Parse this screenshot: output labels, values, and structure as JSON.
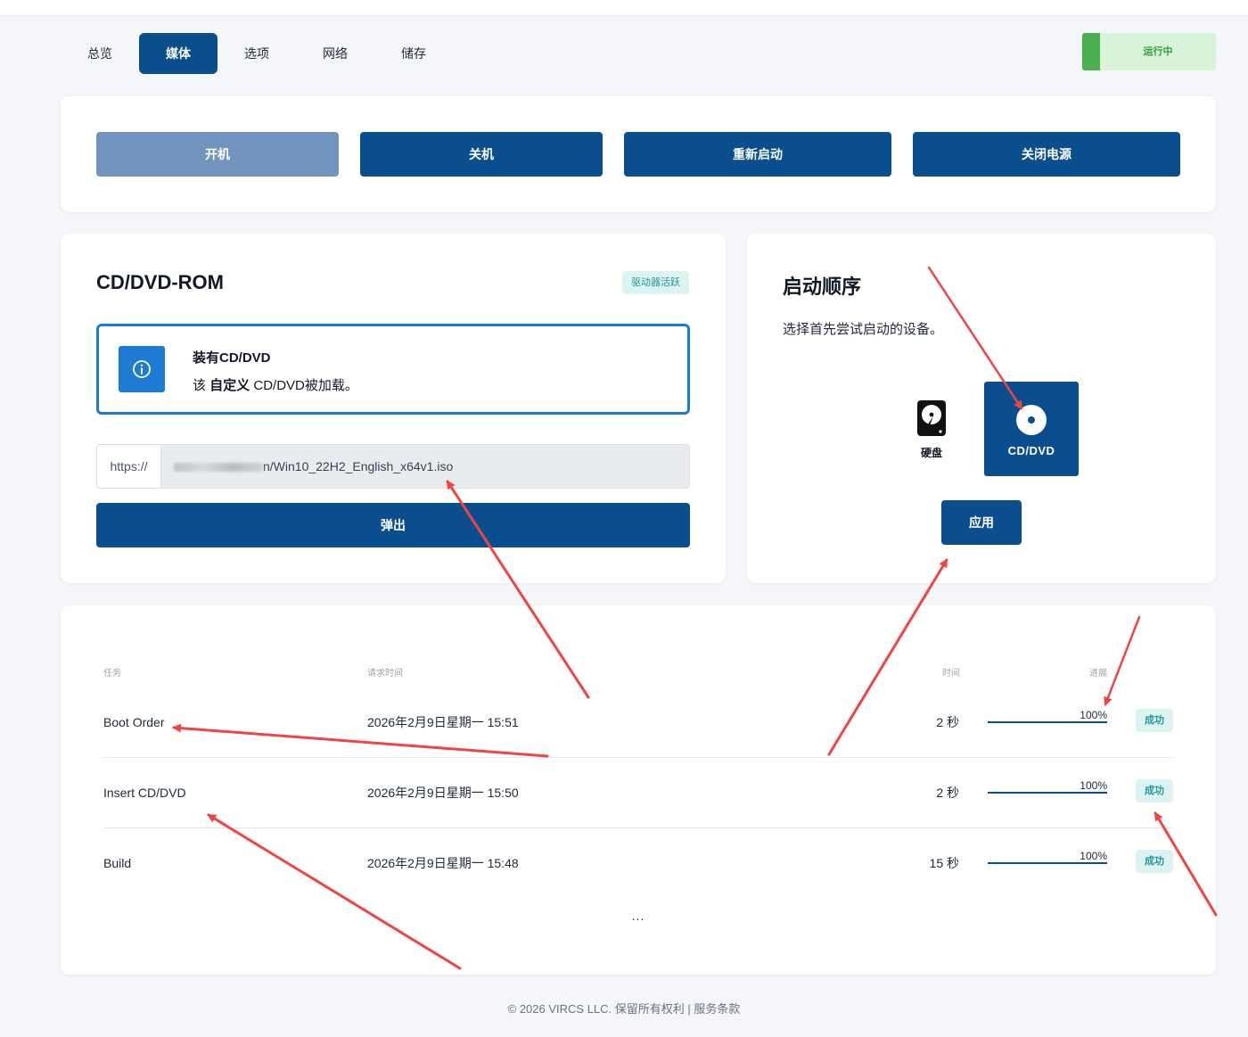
{
  "tabs": [
    {
      "label": "总览"
    },
    {
      "label": "媒体",
      "active": true
    },
    {
      "label": "选项"
    },
    {
      "label": "网络"
    },
    {
      "label": "储存"
    }
  ],
  "status": {
    "label": "运行中",
    "color": "#4caf50"
  },
  "power": {
    "power_on": "开机",
    "shutdown": "关机",
    "restart": "重新启动",
    "power_off": "关闭电源"
  },
  "cdrom": {
    "title": "CD/DVD-ROM",
    "badge": "驱动器活跃",
    "info_title": "装有CD/DVD",
    "info_prefix": "该",
    "info_strong": "自定义",
    "info_suffix": "CD/DVD被加载。",
    "url_prefix": "https://",
    "url_value": "n/Win10_22H2_English_x64v1.iso",
    "eject": "弹出"
  },
  "boot": {
    "title": "启动顺序",
    "description": "选择首先尝试启动的设备。",
    "hdd_label": "硬盘",
    "cd_label": "CD/DVD",
    "selected": "CD/DVD",
    "apply": "应用"
  },
  "tasks": {
    "headers": {
      "task": "任务",
      "requested": "请求时间",
      "duration": "时间",
      "progress": "进展"
    },
    "rows": [
      {
        "task": "Boot Order",
        "requested": "2026年2月9日星期一 15:51",
        "duration": "2 秒",
        "progress": "100%",
        "status": "成功"
      },
      {
        "task": "Insert CD/DVD",
        "requested": "2026年2月9日星期一 15:50",
        "duration": "2 秒",
        "progress": "100%",
        "status": "成功"
      },
      {
        "task": "Build",
        "requested": "2026年2月9日星期一 15:48",
        "duration": "15 秒",
        "progress": "100%",
        "status": "成功"
      }
    ],
    "more": "..."
  },
  "footer": "© 2026 VIRCS LLC. 保留所有权利 | 服务条款",
  "colors": {
    "primary": "#0b4e8e",
    "info": "#1e7bd4",
    "success_badge": "#1f9a95",
    "annotation": "#ef4444"
  }
}
